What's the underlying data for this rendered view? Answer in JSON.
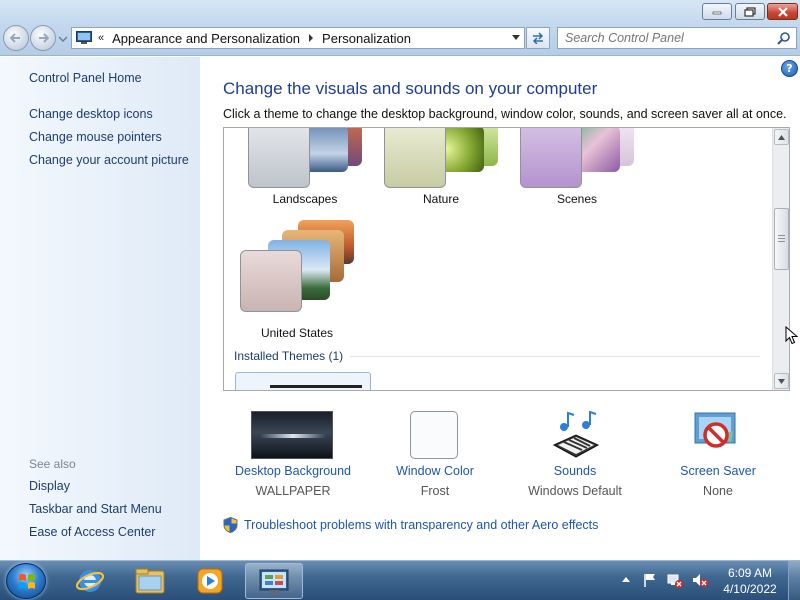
{
  "window": {
    "address": {
      "root_chevron": "«",
      "crumbs": [
        "Appearance and Personalization",
        "Personalization"
      ]
    },
    "search_placeholder": "Search Control Panel"
  },
  "left_pane": {
    "home": "Control Panel Home",
    "links": [
      "Change desktop icons",
      "Change mouse pointers",
      "Change your account picture"
    ],
    "see_also_heading": "See also",
    "see_also": [
      "Display",
      "Taskbar and Start Menu",
      "Ease of Access Center"
    ]
  },
  "main": {
    "help": "?",
    "title": "Change the visuals and sounds on your computer",
    "subtitle": "Click a theme to change the desktop background, window color, sounds, and screen saver all at once.",
    "themes": [
      {
        "name": "Landscapes",
        "icon": "landscapes-theme-icon"
      },
      {
        "name": "Nature",
        "icon": "nature-theme-icon"
      },
      {
        "name": "Scenes",
        "icon": "scenes-theme-icon"
      },
      {
        "name": "United States",
        "icon": "united-states-theme-icon"
      }
    ],
    "installed_heading": "Installed Themes (1)",
    "options": [
      {
        "label": "Desktop Background",
        "value": "WALLPAPER",
        "icon": "wallpaper-thumbnail-icon"
      },
      {
        "label": "Window Color",
        "value": "Frost",
        "icon": "window-color-swatch-icon"
      },
      {
        "label": "Sounds",
        "value": "Windows Default",
        "icon": "piano-music-notes-icon"
      },
      {
        "label": "Screen Saver",
        "value": "None",
        "icon": "no-screen-saver-icon"
      }
    ],
    "troubleshoot": "Troubleshoot problems with transparency and other Aero effects"
  },
  "taskbar": {
    "pinned": [
      "internet-explorer-icon",
      "windows-explorer-icon",
      "media-player-icon",
      "control-panel-icon"
    ],
    "clock_time": "6:09 AM",
    "clock_date": "4/10/2022"
  },
  "colors": {
    "link_blue": "#1e56a8",
    "title_blue": "#1e3d8f",
    "left_pane_bg": "#dfeaf7",
    "taskbar": "#3f6790"
  }
}
